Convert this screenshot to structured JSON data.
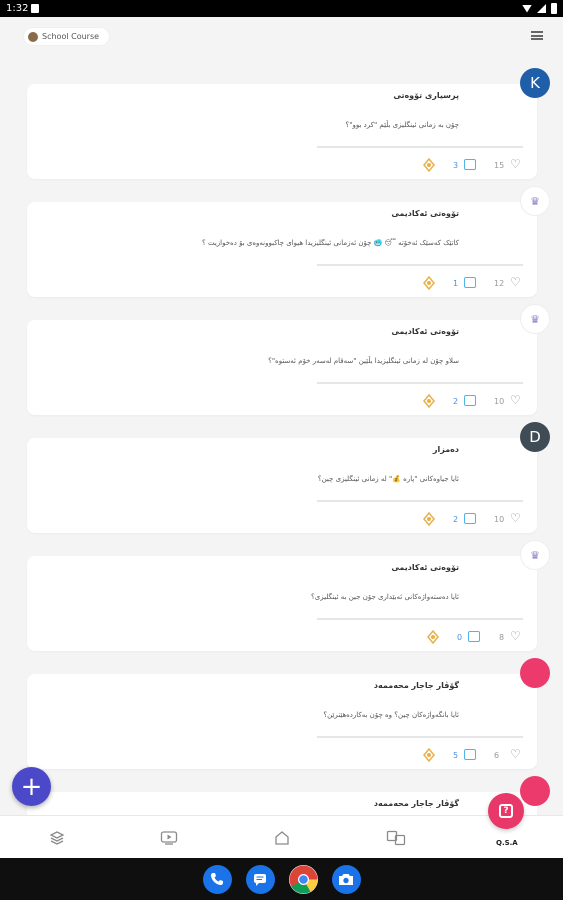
{
  "status": {
    "time": "1:32"
  },
  "header": {
    "chip_label": "School Course"
  },
  "posts": [
    {
      "author": "پرسیاری تۆوەتی",
      "question": "چۆن بە زمانی ئینگلیزی بڵێم \"کرد بوو\"؟",
      "likes": "15",
      "comments": "3",
      "avatar_letter": "K",
      "avatar_color": "#1f5ea8"
    },
    {
      "author": "تۆوەتی ئەکادیمی",
      "question": "کاتێک کەسێک ئەخۆتە 😴 🥶 چۆن ئەزمانی ئینگلیزیدا هیوای چاکبوونەوەی بۆ دەخوازیت ؟",
      "likes": "12",
      "comments": "1",
      "avatar_letter": "",
      "avatar_color": "#ffffff"
    },
    {
      "author": "تۆوەتی ئەکادیمی",
      "question": "سلاو چۆن لە زمانی ئینگلیزیدا بڵێین \"سەقام لەسەر خۆم ئەستوە\"؟",
      "likes": "10",
      "comments": "2",
      "avatar_letter": "",
      "avatar_color": "#ffffff"
    },
    {
      "author": "دەمزار",
      "question": "ئایا جیاوەکانی \"پارە 💰\" لە زمانی ئینگلیزی چین؟",
      "likes": "10",
      "comments": "2",
      "avatar_letter": "D",
      "avatar_color": "#3f4b55"
    },
    {
      "author": "تۆوەتی ئەکادیمی",
      "question": "ئایا دەستەواژەکانی ئەبێداری جۆن جین بە ئینگلیزی؟",
      "likes": "8",
      "comments": "0",
      "avatar_letter": "",
      "avatar_color": "#ffffff"
    },
    {
      "author": "گۆڤار جاجار محەممەد",
      "question": "ئایا بانگەواژەکان چین؟ وە چۆن بەکاردەهێنرێن؟",
      "likes": "6",
      "comments": "5",
      "avatar_letter": "",
      "avatar_color": "#ec3a6c"
    },
    {
      "author": "گۆڤار جاجار محەممەد",
      "question": "",
      "likes": "",
      "comments": "",
      "avatar_letter": "",
      "avatar_color": "#ec3a6c"
    }
  ],
  "fab": {
    "label": "+"
  },
  "bottom_nav": {
    "qa_label": "Q.S.A"
  },
  "colors": {
    "accent": "#4b49c8",
    "qa": "#e8386a"
  }
}
